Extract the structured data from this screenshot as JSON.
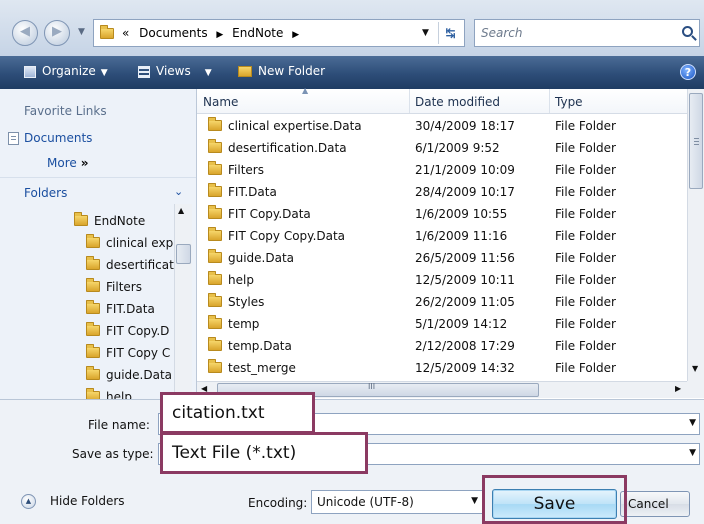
{
  "address": {
    "back_icon": "back-arrow-icon",
    "forward_icon": "forward-arrow-icon",
    "breadcrumb_prefix": "«",
    "crumbs": [
      "Documents",
      "EndNote"
    ],
    "search_placeholder": "Search"
  },
  "toolbar": {
    "organize": "Organize",
    "views": "Views",
    "new_folder": "New Folder",
    "help": "?"
  },
  "nav": {
    "favorites_title": "Favorite Links",
    "favorites": [
      "Documents"
    ],
    "more": "More",
    "more_arrow": "»",
    "folders_title": "Folders",
    "tree_root": "EndNote",
    "tree_children": [
      "clinical exp",
      "desertificat",
      "Filters",
      "FIT.Data",
      "FIT Copy.D",
      "FIT Copy C",
      "guide.Data",
      "help"
    ]
  },
  "list": {
    "columns": [
      "Name",
      "Date modified",
      "Type"
    ],
    "rows": [
      {
        "name": "clinical expertise.Data",
        "date": "30/4/2009 18:17",
        "type": "File Folder"
      },
      {
        "name": "desertification.Data",
        "date": "6/1/2009 9:52",
        "type": "File Folder"
      },
      {
        "name": "Filters",
        "date": "21/1/2009 10:09",
        "type": "File Folder"
      },
      {
        "name": "FIT.Data",
        "date": "28/4/2009 10:17",
        "type": "File Folder"
      },
      {
        "name": "FIT Copy.Data",
        "date": "1/6/2009 10:55",
        "type": "File Folder"
      },
      {
        "name": "FIT Copy Copy.Data",
        "date": "1/6/2009 11:16",
        "type": "File Folder"
      },
      {
        "name": "guide.Data",
        "date": "26/5/2009 11:56",
        "type": "File Folder"
      },
      {
        "name": "help",
        "date": "12/5/2009 10:11",
        "type": "File Folder"
      },
      {
        "name": "Styles",
        "date": "26/2/2009 11:05",
        "type": "File Folder"
      },
      {
        "name": "temp",
        "date": "5/1/2009 14:12",
        "type": "File Folder"
      },
      {
        "name": "temp.Data",
        "date": "2/12/2008 17:29",
        "type": "File Folder"
      },
      {
        "name": "test_merge",
        "date": "12/5/2009 14:32",
        "type": "File Folder"
      }
    ],
    "hscroll_grip": "III"
  },
  "form": {
    "file_name_label": "File name:",
    "file_name_value": "citation.txt",
    "save_type_label": "Save as type:",
    "save_type_value": "Text File (*.txt)",
    "hide_folders": "Hide Folders",
    "encoding_label": "Encoding:",
    "encoding_value": "Unicode (UTF-8)",
    "save": "Save",
    "cancel": "Cancel"
  },
  "colors": {
    "highlight_border": "#8b3a62",
    "toolbar_bg": "#2d4d78",
    "link_blue": "#1b4fa0"
  }
}
